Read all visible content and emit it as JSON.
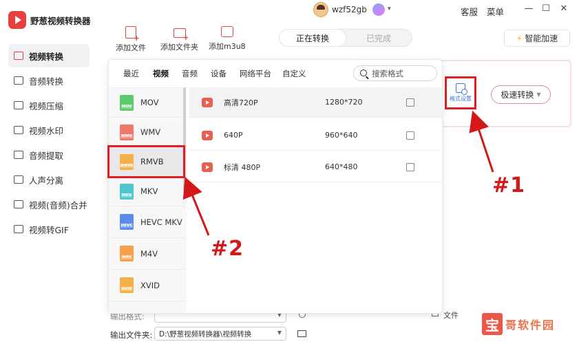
{
  "app": {
    "title": "野葱视频转换器",
    "brand_color": "#e8403f"
  },
  "header": {
    "username": "wzf52gb",
    "support": "客服",
    "menu": "菜单"
  },
  "sidebar": {
    "items": [
      {
        "label": "视频转换",
        "icon": "video-convert-icon",
        "active": true
      },
      {
        "label": "音频转换",
        "icon": "audio-convert-icon",
        "active": false
      },
      {
        "label": "视频压缩",
        "icon": "video-compress-icon",
        "active": false
      },
      {
        "label": "视频水印",
        "icon": "watermark-icon",
        "active": false
      },
      {
        "label": "音频提取",
        "icon": "audio-extract-icon",
        "active": false
      },
      {
        "label": "人声分离",
        "icon": "voice-separate-icon",
        "active": false
      },
      {
        "label": "视频(音频)合并",
        "icon": "merge-icon",
        "active": false
      },
      {
        "label": "视频转GIF",
        "icon": "gif-icon",
        "active": false
      }
    ]
  },
  "toolbar": {
    "add_file": "添加文件",
    "add_folder": "添加文件夹",
    "add_m3u8": "添加m3u8",
    "tab_converting": "正在转换",
    "tab_done": "已完成",
    "smart_speed": "智能加速"
  },
  "task": {
    "format_settings": "格式设置",
    "fast_convert": "极速转换"
  },
  "popup": {
    "categories": [
      "最近",
      "视频",
      "音频",
      "设备",
      "网络平台",
      "自定义"
    ],
    "active_category": "视频",
    "search_placeholder": "搜索格式",
    "formats": [
      {
        "name": "MOV",
        "color": "#5cc96a",
        "selected": false
      },
      {
        "name": "WMV",
        "color": "#f07a6a",
        "selected": false
      },
      {
        "name": "RMVB",
        "color": "#f5b04a",
        "selected": true
      },
      {
        "name": "MKV",
        "color": "#4fc7cf",
        "selected": false
      },
      {
        "name": "HEVC MKV",
        "color": "#5b8de8",
        "selected": false
      },
      {
        "name": "M4V",
        "color": "#f5a04a",
        "selected": false
      },
      {
        "name": "XVID",
        "color": "#f5b04a",
        "selected": false
      }
    ],
    "resolutions": [
      {
        "name": "高清720P",
        "size": "1280*720",
        "selected": true
      },
      {
        "name": "640P",
        "size": "960*640",
        "selected": false
      },
      {
        "name": "标清 480P",
        "size": "640*480",
        "selected": false
      }
    ]
  },
  "bottom": {
    "output_folder_label": "输出文件夹:",
    "output_path": "D:\\野葱视频转换器\\视频转换",
    "clear_files": "文件",
    "hidden_label": "输出格式:",
    "hidden_path": ""
  },
  "annotations": {
    "marker1": "#1",
    "marker2": "#2",
    "color": "#d41818"
  },
  "watermark": {
    "first_char": "宝",
    "rest": "哥软件园"
  }
}
